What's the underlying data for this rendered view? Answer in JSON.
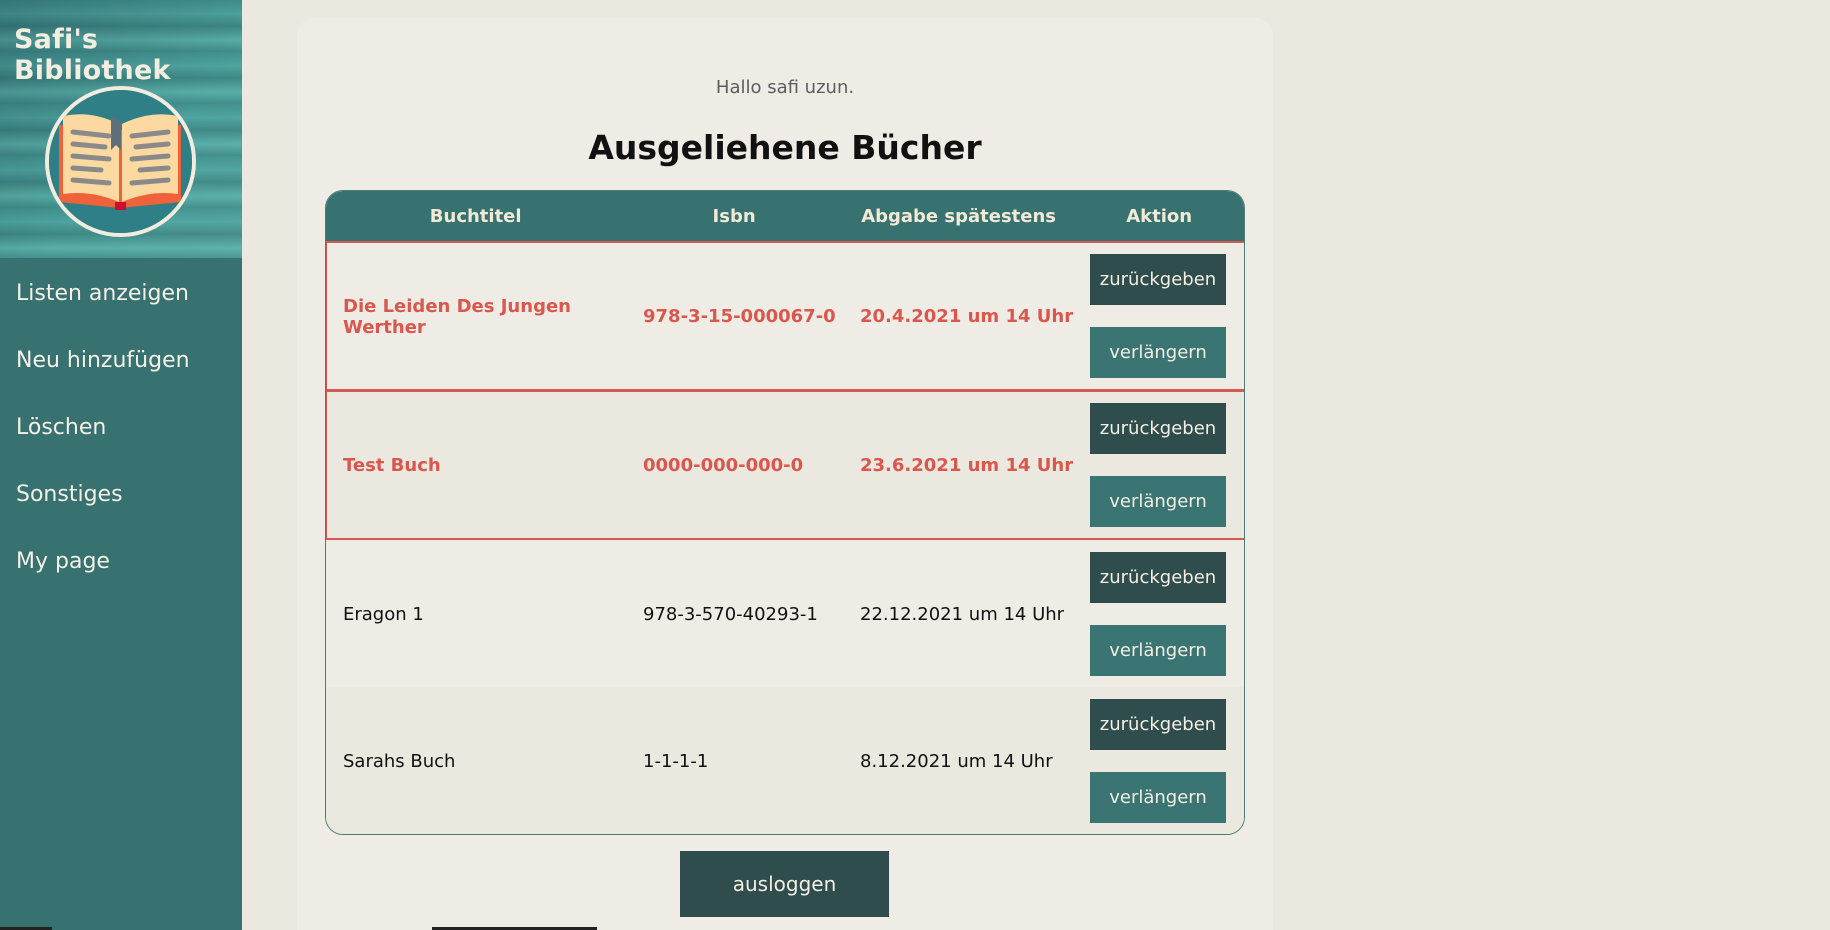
{
  "sidebar": {
    "brand": "Safi's Bibliothek",
    "logo_icon": "open-book-icon",
    "items": [
      {
        "label": "Listen anzeigen"
      },
      {
        "label": "Neu hinzufügen"
      },
      {
        "label": "Löschen"
      },
      {
        "label": "Sonstiges"
      },
      {
        "label": "My page"
      }
    ]
  },
  "main": {
    "greeting": "Hallo safi uzun.",
    "title": "Ausgeliehene Bücher",
    "table": {
      "headers": [
        "Buchtitel",
        "Isbn",
        "Abgabe spätestens",
        "Aktion"
      ],
      "rows": [
        {
          "title": "Die Leiden Des Jungen Werther",
          "isbn": "978-3-15-000067-0",
          "due": "20.4.2021 um 14 Uhr",
          "return_label": "zurückgeben",
          "extend_label": "verlängern",
          "overdue": true
        },
        {
          "title": "Test Buch",
          "isbn": "0000-000-000-0",
          "due": "23.6.2021 um 14 Uhr",
          "return_label": "zurückgeben",
          "extend_label": "verlängern",
          "overdue": true
        },
        {
          "title": "Eragon 1",
          "isbn": "978-3-570-40293-1",
          "due": "22.12.2021 um 14 Uhr",
          "return_label": "zurückgeben",
          "extend_label": "verlängern",
          "overdue": false
        },
        {
          "title": "Sarahs Buch",
          "isbn": "1-1-1-1",
          "due": "8.12.2021 um 14 Uhr",
          "return_label": "zurückgeben",
          "extend_label": "verlängern",
          "overdue": false
        }
      ]
    },
    "logout_label": "ausloggen"
  },
  "colors": {
    "sidebar": "#377170",
    "overdue_text": "#d9574d",
    "button_dark": "#2e4d4c",
    "button_teal": "#3a7573",
    "page_bg": "#ebe8df"
  }
}
